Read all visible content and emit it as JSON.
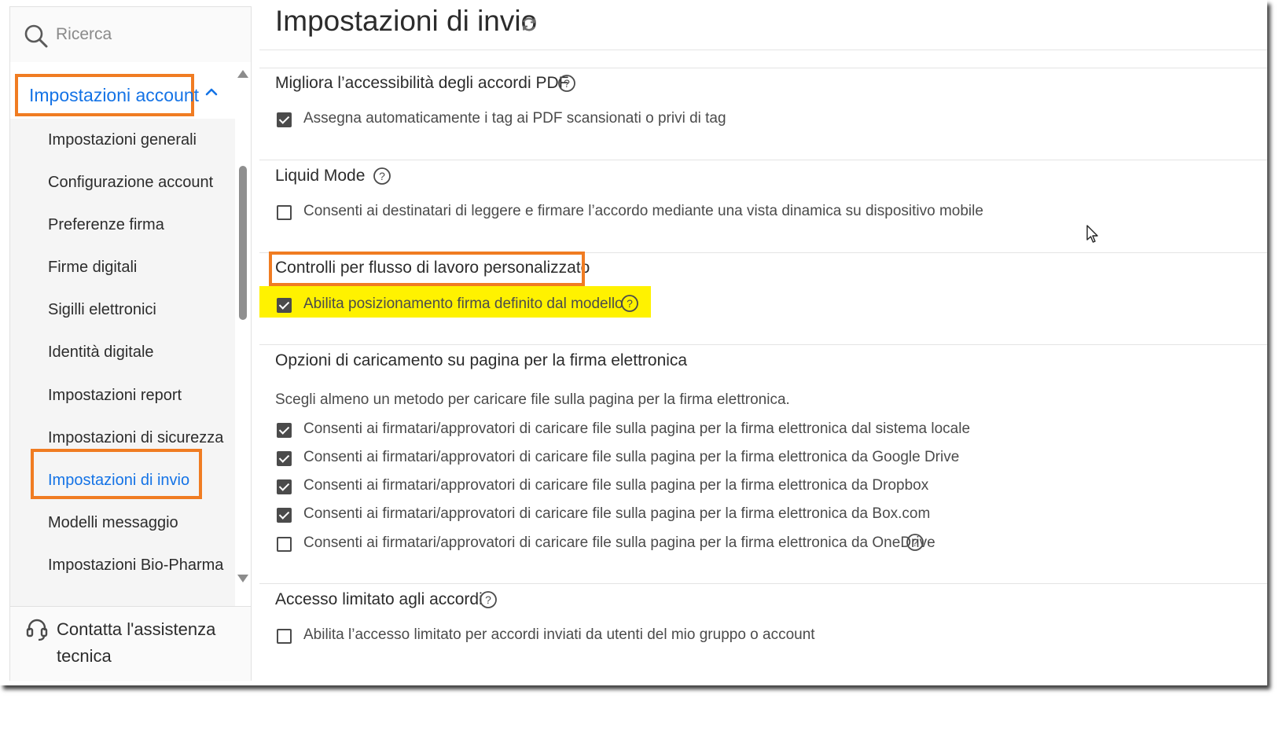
{
  "search": {
    "placeholder": "Ricerca",
    "icon": "search-icon"
  },
  "sidebar": {
    "section_label": "Impostazioni account",
    "items": [
      {
        "label": "Impostazioni generali",
        "active": false
      },
      {
        "label": "Configurazione account",
        "active": false
      },
      {
        "label": "Preferenze firma",
        "active": false
      },
      {
        "label": "Firme digitali",
        "active": false
      },
      {
        "label": "Sigilli elettronici",
        "active": false
      },
      {
        "label": "Identità digitale",
        "active": false
      },
      {
        "label": "Impostazioni report",
        "active": false
      },
      {
        "label": "Impostazioni di sicurezza",
        "active": false
      },
      {
        "label": "Impostazioni di invio",
        "active": true
      },
      {
        "label": "Modelli messaggio",
        "active": false
      },
      {
        "label": "Impostazioni Bio-Pharma",
        "active": false
      }
    ],
    "support_label": "Contatta l'assistenza tecnica"
  },
  "main": {
    "title": "Impostazioni di invio",
    "sections": [
      {
        "title": "Migliora l’accessibilità degli accordi PDF",
        "options": [
          {
            "label": "Assegna automaticamente i tag ai PDF scansionati o privi di tag",
            "checked": true
          }
        ]
      },
      {
        "title": "Liquid Mode",
        "options": [
          {
            "label": "Consenti ai destinatari di leggere e firmare l’accordo mediante una vista dinamica su dispositivo mobile",
            "checked": false
          }
        ]
      },
      {
        "title": "Controlli per flusso di lavoro personalizzato",
        "options": [
          {
            "label": "Abilita posizionamento firma definito dal modello",
            "checked": true
          }
        ]
      },
      {
        "title": "Opzioni di caricamento su pagina per la firma elettronica",
        "description": "Scegli almeno un metodo per caricare file sulla pagina per la firma elettronica.",
        "options": [
          {
            "label": "Consenti ai firmatari/approvatori di caricare file sulla pagina per la firma elettronica dal sistema locale",
            "checked": true
          },
          {
            "label": "Consenti ai firmatari/approvatori di caricare file sulla pagina per la firma elettronica da Google Drive",
            "checked": true
          },
          {
            "label": "Consenti ai firmatari/approvatori di caricare file sulla pagina per la firma elettronica da Dropbox",
            "checked": true
          },
          {
            "label": "Consenti ai firmatari/approvatori di caricare file sulla pagina per la firma elettronica da Box.com",
            "checked": true
          },
          {
            "label": "Consenti ai firmatari/approvatori di caricare file sulla pagina per la firma elettronica da OneDrive",
            "checked": false
          }
        ]
      },
      {
        "title": "Accesso limitato agli accordi",
        "options": [
          {
            "label": "Abilita l’accesso limitato per accordi inviati da utenti del mio gruppo o account",
            "checked": false
          }
        ]
      }
    ]
  },
  "colors": {
    "accent_blue": "#1473e6",
    "annotation_orange": "#f07c22",
    "highlight_yellow": "#fff200",
    "text_dark": "#2c2c2c",
    "text_body": "#4b4b4b"
  }
}
